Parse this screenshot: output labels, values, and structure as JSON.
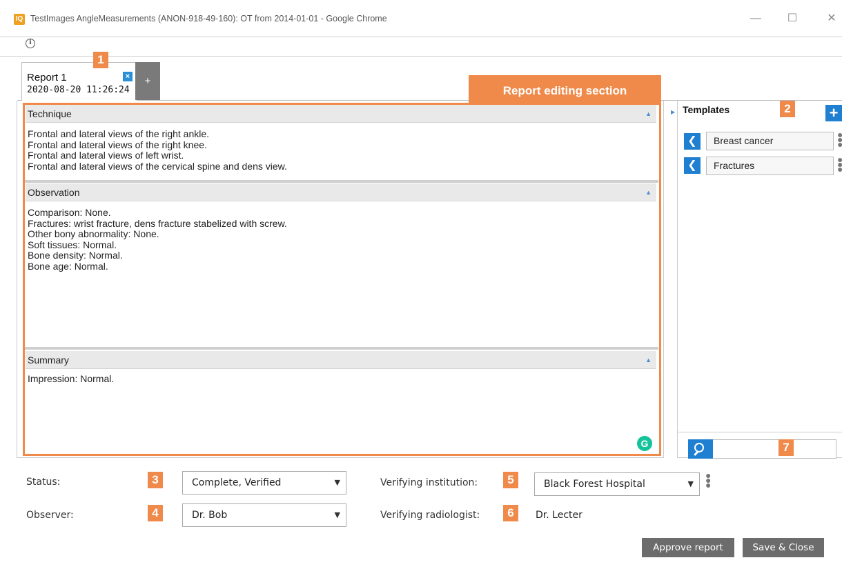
{
  "window": {
    "logo_text": "IQ",
    "title": "TestImages AngleMeasurements (ANON-918-49-160): OT from 2014-01-01 - Google Chrome",
    "minimize": "—",
    "maximize": "☐",
    "close": "✕"
  },
  "address_bar": {
    "info_icon": "i"
  },
  "tabs": {
    "report_name": "Report 1",
    "report_date": "2020-08-20 11:26:24",
    "close_glyph": "×",
    "add_glyph": "+"
  },
  "badges": {
    "b1": "1",
    "b2": "2",
    "b3": "3",
    "b4": "4",
    "b5": "5",
    "b6": "6",
    "b7": "7",
    "section": "Report editing section"
  },
  "sections": {
    "technique": {
      "title": "Technique",
      "body": "Frontal and lateral views of the right ankle.\nFrontal and lateral views of the right knee.\nFrontal and lateral views of left wrist.\nFrontal and lateral views of the cervical spine and dens view."
    },
    "observation": {
      "title": "Observation",
      "body": "Comparison: None.\nFractures: wrist fracture, dens fracture stabelized with screw.\nOther bony abnormality: None.\nSoft tissues: Normal.\nBone density: Normal.\nBone age: Normal."
    },
    "summary": {
      "title": "Summary",
      "body": "Impression: Normal."
    },
    "collapse_glyph": "▲",
    "grammarly_glyph": "G"
  },
  "templates": {
    "title": "Templates",
    "add_glyph": "+",
    "items": [
      {
        "label": "Breast cancer"
      },
      {
        "label": "Fractures"
      }
    ],
    "chevron_glyph": "❮",
    "kebab_glyph": "⋮"
  },
  "form": {
    "status_label": "Status:",
    "status_value": "Complete, Verified",
    "observer_label": "Observer:",
    "observer_value": "Dr. Bob",
    "institution_label": "Verifying institution:",
    "institution_value": "Black Forest Hospital",
    "radiologist_label": "Verifying radiologist:",
    "radiologist_value": "Dr. Lecter",
    "caret_glyph": "⌄"
  },
  "buttons": {
    "approve": "Approve report",
    "save_close": "Save & Close"
  },
  "colors": {
    "annotation": "#f08a4a",
    "accent_blue": "#1f7fd0",
    "button_gray": "#6c6c6c"
  }
}
